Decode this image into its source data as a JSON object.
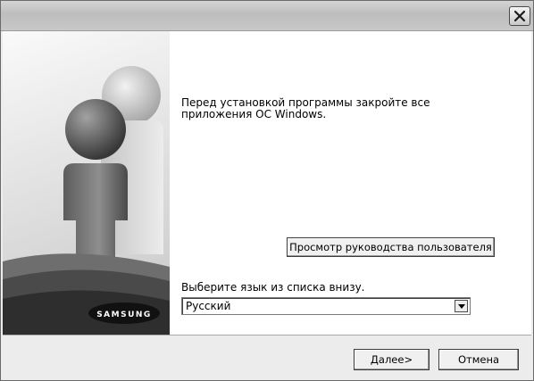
{
  "dialog": {
    "message": "Перед установкой программы закройте все приложения ОС Windows.",
    "view_guide_label": "Просмотр руководства пользователя",
    "language_prompt": "Выберите язык из списка внизу.",
    "language_selected": "Русский",
    "brand_logo": "SAMSUNG"
  },
  "buttons": {
    "next_label": "Далее>",
    "cancel_label": "Отмена"
  },
  "icons": {
    "close": "close-icon",
    "dropdown": "chevron-down-icon"
  }
}
